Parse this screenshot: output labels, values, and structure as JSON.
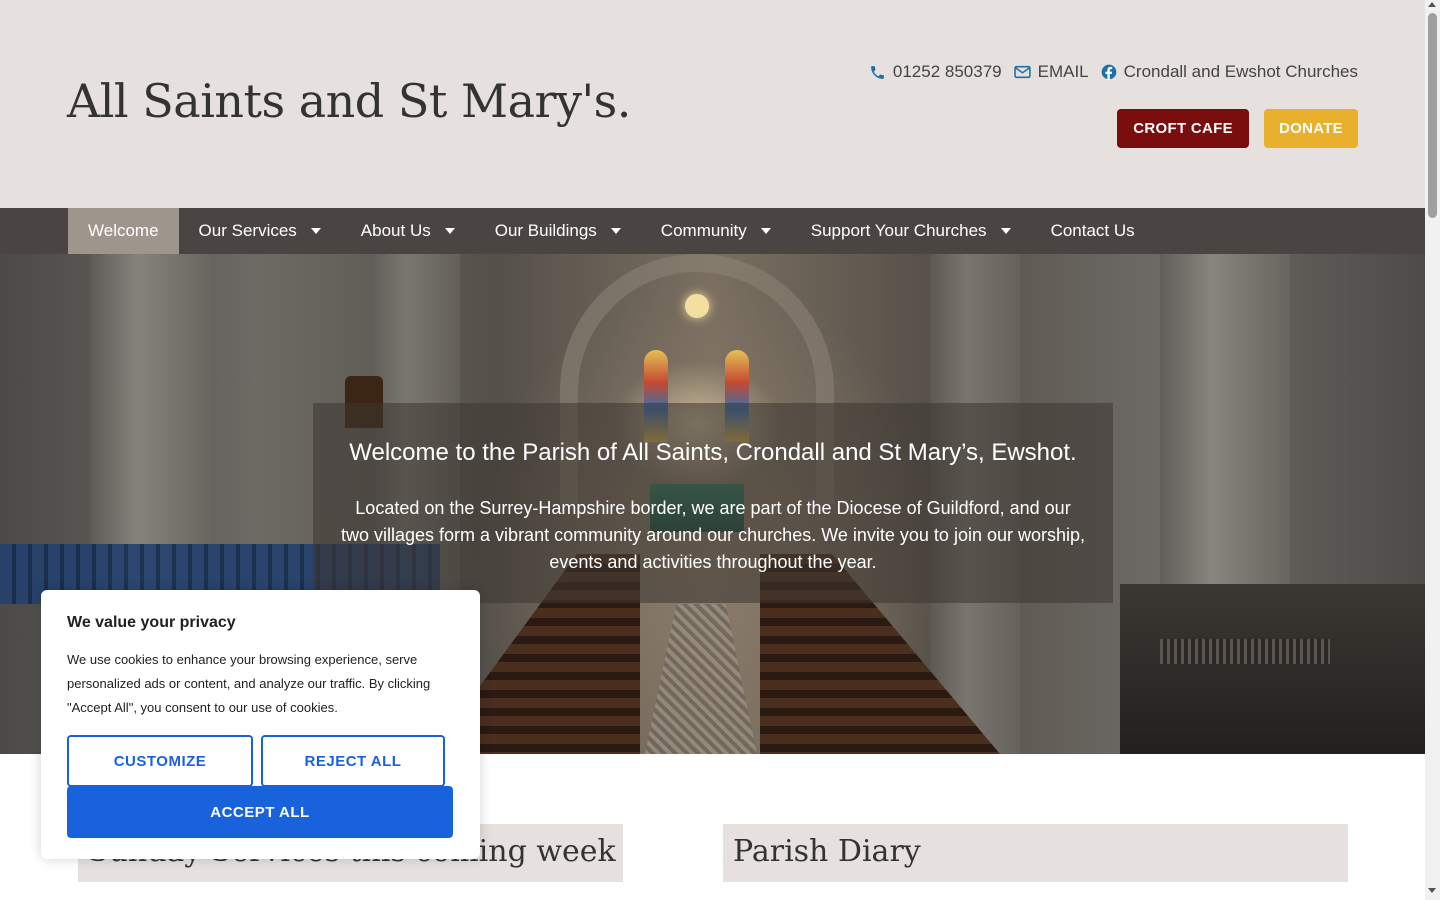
{
  "header": {
    "site_title": "All Saints and St Mary's.",
    "contact": {
      "phone": "01252 850379",
      "email": "EMAIL",
      "facebook": "Crondall and Ewshot Churches"
    },
    "buttons": {
      "croft_cafe": "CROFT CAFE",
      "donate": "DONATE"
    }
  },
  "nav": {
    "items": [
      {
        "label": "Welcome"
      },
      {
        "label": "Our Services"
      },
      {
        "label": "About Us"
      },
      {
        "label": "Our Buildings"
      },
      {
        "label": "Community"
      },
      {
        "label": "Support Your Churches"
      },
      {
        "label": "Contact Us"
      }
    ]
  },
  "hero": {
    "title": "Welcome to the Parish of All Saints, Crondall and St Mary’s, Ewshot.",
    "text": "Located on the Surrey-Hampshire border, we are part of the Diocese of Guildford, and our two villages form a vibrant community around our churches.  We invite you to join our worship, events and activities throughout the year."
  },
  "sections": {
    "sunday_services": "Sunday Services this coming week",
    "parish_diary": "Parish Diary"
  },
  "cookie_banner": {
    "title": "We value your privacy",
    "text": "We use cookies to enhance your browsing experience, serve personalized ads or content, and analyze our traffic. By clicking \"Accept All\", you consent to our use of cookies.",
    "customize": "CUSTOMIZE",
    "reject_all": "REJECT ALL",
    "accept_all": "ACCEPT ALL"
  },
  "colors": {
    "header_bg": "#e6e1de",
    "nav_bg": "#4a4542",
    "nav_active": "#9e958d",
    "croft_cafe": "#7a0d0d",
    "donate": "#e9b02e",
    "contact_icon": "#1e6fa8",
    "cookie_accent": "#1863dc"
  },
  "icons": {
    "phone": "phone-icon",
    "email": "envelope-icon",
    "facebook": "facebook-icon",
    "dropdown": "caret-down-icon"
  }
}
